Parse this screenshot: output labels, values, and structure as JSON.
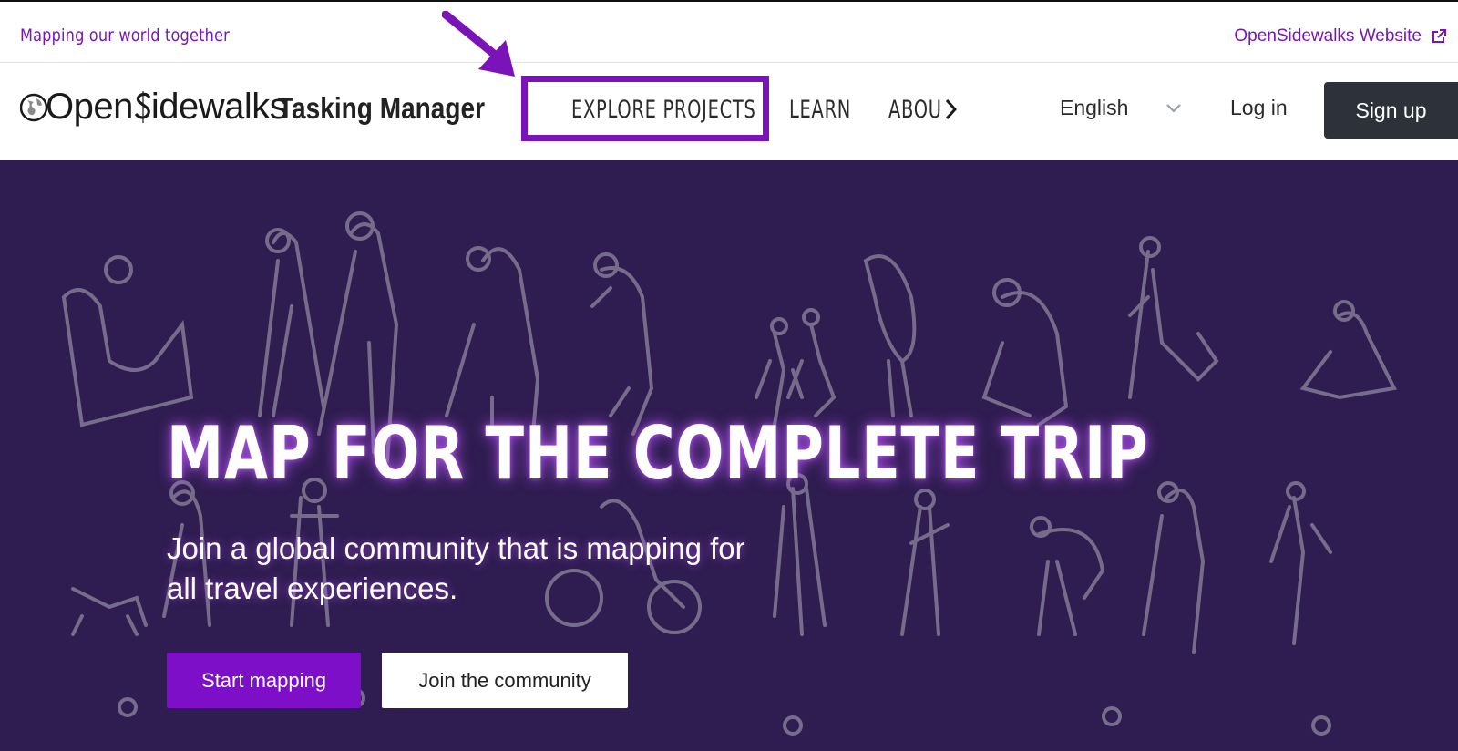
{
  "topbar": {
    "tagline": "Mapping our world together",
    "external_link": "OpenSidewalks Website"
  },
  "navbar": {
    "logo_open": "Open",
    "logo_rest": "idewalks",
    "product_title": "Tasking Manager",
    "items": [
      {
        "label": "EXPLORE PROJECTS"
      },
      {
        "label": "LEARN"
      },
      {
        "label": "ABOU"
      }
    ],
    "language": "English",
    "login": "Log in",
    "signup": "Sign up"
  },
  "hero": {
    "title": "MAP FOR THE COMPLETE TRIP",
    "subtitle": "Join a global community that is mapping for all travel experiences.",
    "primary_button": "Start mapping",
    "secondary_button": "Join the community"
  },
  "colors": {
    "brand_purple": "#7a14b8",
    "hero_background": "#2f1c50",
    "signup_button": "#2d3139",
    "start_button": "#7e0fc8"
  },
  "icons": [
    "external-link-icon",
    "globe-logo-icon",
    "chevron-right-icon",
    "chevron-down-icon",
    "annotation-arrow-icon"
  ]
}
